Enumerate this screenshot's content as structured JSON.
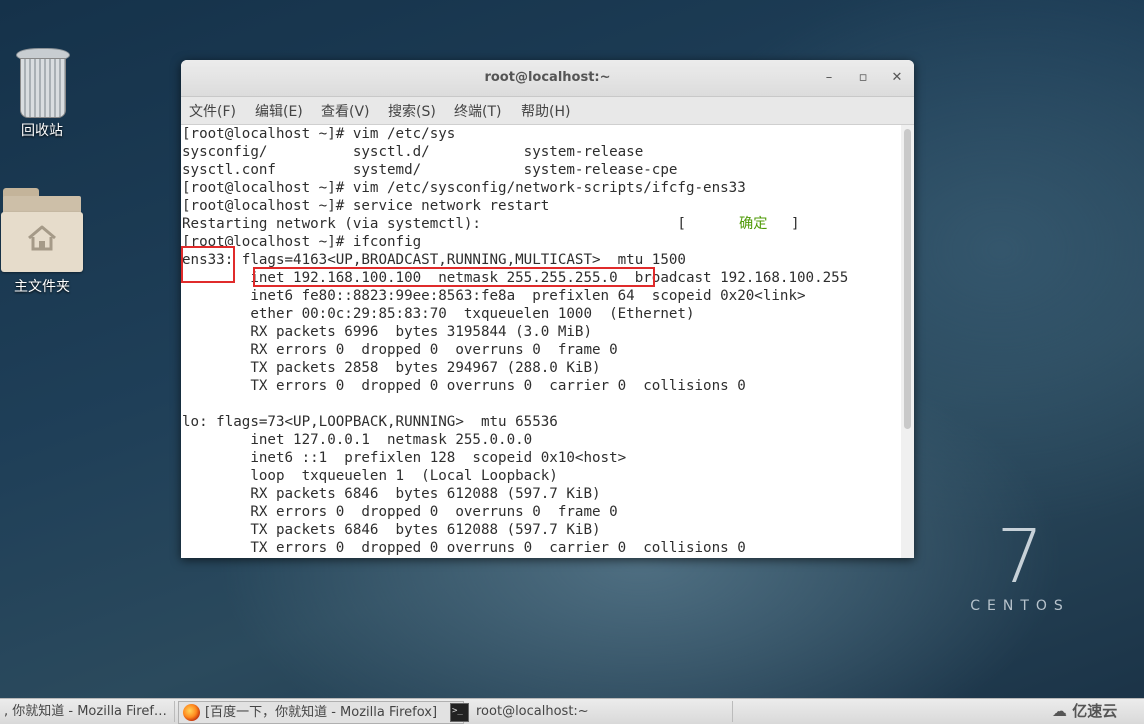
{
  "desktop": {
    "icons": [
      {
        "label": "回收站"
      },
      {
        "label": "主文件夹"
      }
    ],
    "brand": {
      "version": "7",
      "name": "CENTOS"
    }
  },
  "window": {
    "title": "root@localhost:~",
    "controls": {
      "minimize": "–",
      "maximize": "▫",
      "close": "✕"
    },
    "menu": [
      "文件(F)",
      "编辑(E)",
      "查看(V)",
      "搜索(S)",
      "终端(T)",
      "帮助(H)"
    ]
  },
  "terminal": {
    "lines": [
      "[root@localhost ~]# vim /etc/sys",
      "sysconfig/          sysctl.d/           system-release",
      "sysctl.conf         systemd/            system-release-cpe",
      "[root@localhost ~]# vim /etc/sysconfig/network-scripts/ifcfg-ens33",
      "[root@localhost ~]# service network restart",
      "Restarting network (via systemctl):                       [",
      "[root@localhost ~]# ifconfig",
      "ens33: flags=4163<UP,BROADCAST,RUNNING,MULTICAST>  mtu 1500",
      "        inet 192.168.100.100  netmask 255.255.255.0  broadcast 192.168.100.255",
      "        inet6 fe80::8823:99ee:8563:fe8a  prefixlen 64  scopeid 0x20<link>",
      "        ether 00:0c:29:85:83:70  txqueuelen 1000  (Ethernet)",
      "        RX packets 6996  bytes 3195844 (3.0 MiB)",
      "        RX errors 0  dropped 0  overruns 0  frame 0",
      "        TX packets 2858  bytes 294967 (288.0 KiB)",
      "        TX errors 0  dropped 0 overruns 0  carrier 0  collisions 0",
      "",
      "lo: flags=73<UP,LOOPBACK,RUNNING>  mtu 65536",
      "        inet 127.0.0.1  netmask 255.0.0.0",
      "        inet6 ::1  prefixlen 128  scopeid 0x10<host>",
      "        loop  txqueuelen 1  (Local Loopback)",
      "        RX packets 6846  bytes 612088 (597.7 KiB)",
      "        RX errors 0  dropped 0  overruns 0  frame 0",
      "        TX packets 6846  bytes 612088 (597.7 KiB)",
      "        TX errors 0  dropped 0 overruns 0  carrier 0  collisions 0"
    ],
    "ok_status": "确定",
    "ok_close": "]"
  },
  "taskbar": {
    "items": [
      {
        "label": ", 你就知道 - Mozilla Firef…"
      },
      {
        "label": "[百度一下，你就知道 - Mozilla Firefox]"
      },
      {
        "label": "root@localhost:~"
      }
    ],
    "watermark": "亿速云"
  },
  "colors": {
    "highlight_box": "#e02b2b",
    "ok_green": "#4e9a06",
    "terminal_bg": "#ffffff"
  }
}
